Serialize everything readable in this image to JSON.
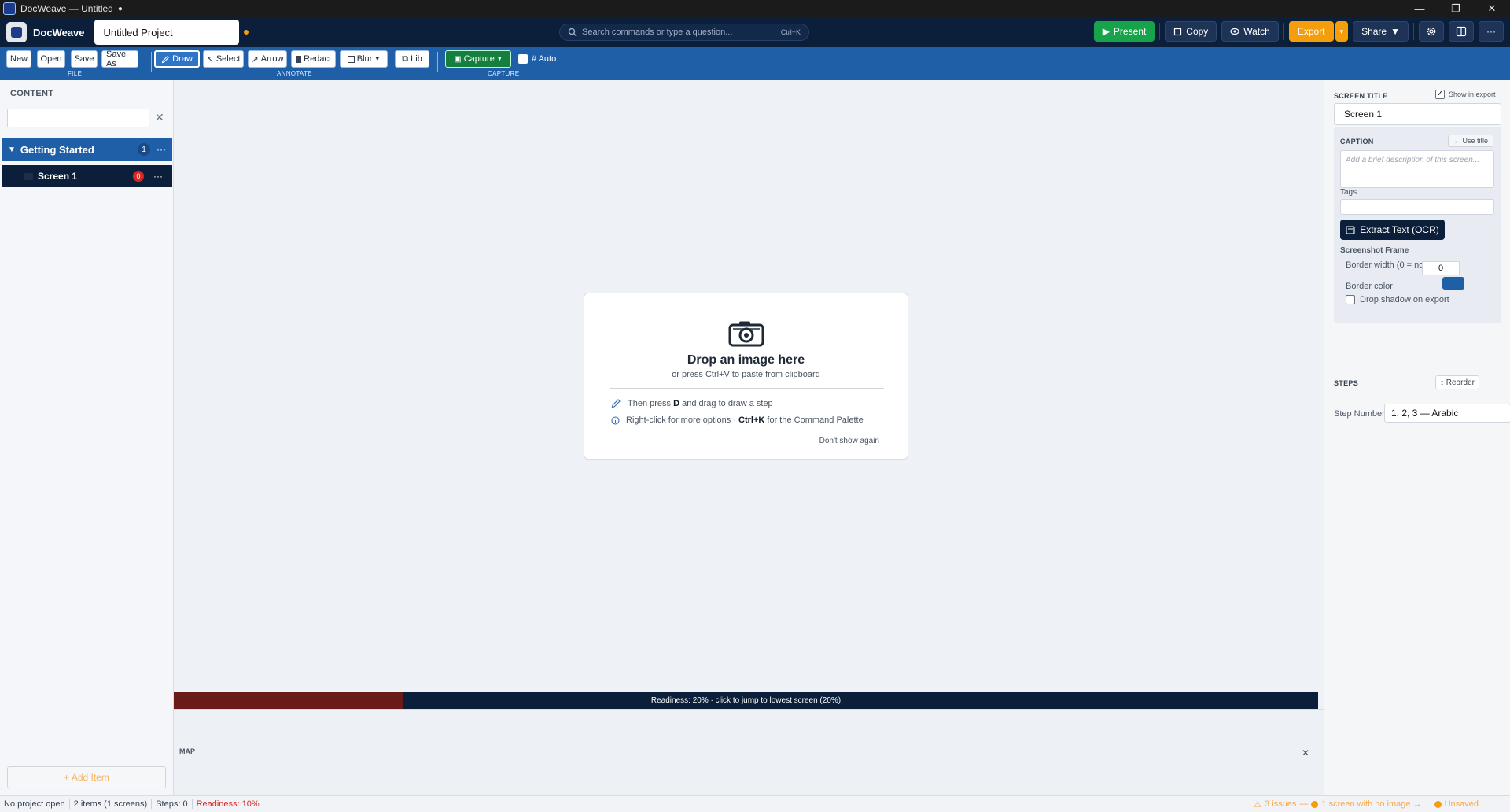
{
  "window": {
    "title": "DocWeave — Untitled",
    "modified_marker": "●",
    "controls": [
      "—",
      "❐",
      "✕"
    ]
  },
  "header": {
    "brand": "DocWeave",
    "project_name": "Untitled Project",
    "search_placeholder": "Search commands or type a question...",
    "search_shortcut": "Ctrl+K",
    "buttons": {
      "present": "Present",
      "copy": "Copy",
      "watch": "Watch",
      "export": "Export",
      "share": "Share"
    },
    "icons": [
      "settings-icon",
      "panel-icon",
      "more-icon"
    ]
  },
  "toolbar": {
    "file": {
      "label": "FILE",
      "new": "New",
      "open": "Open",
      "save": "Save",
      "save_as": "Save As"
    },
    "annotate": {
      "label": "ANNOTATE",
      "draw": "Draw",
      "select": "Select",
      "arrow": "Arrow",
      "redact": "Redact",
      "blur": "Blur",
      "lib": "Lib"
    },
    "capture": {
      "label": "CAPTURE",
      "capture": "Capture",
      "auto": "# Auto"
    }
  },
  "sidebar": {
    "heading": "CONTENT",
    "search_value": "",
    "groups": [
      {
        "label": "Getting Started",
        "count": "1",
        "expanded": true,
        "more": "···"
      }
    ],
    "screens": [
      {
        "label": "Screen 1",
        "badge": "0",
        "more": "···",
        "selected": true
      }
    ],
    "add_item": "+ Add Item"
  },
  "canvas": {
    "drop_title": "Drop an image here",
    "drop_subtitle": "or press Ctrl+V to paste from clipboard",
    "hint1_pre": "Then press ",
    "hint1_key": "D",
    "hint1_post": " and drag to draw a step",
    "hint2_pre": "Right-click for more options · ",
    "hint2_key": "Ctrl+K",
    "hint2_post": " for the Command Palette",
    "dont_show": "Don't show again"
  },
  "readiness_bar": {
    "text": "Readiness: 20%  ·  click to jump to lowest screen (20%)",
    "fraction": 0.2
  },
  "map": {
    "label": "MAP",
    "close": "✕"
  },
  "inspector": {
    "screen_title_label": "SCREEN TITLE",
    "show_in_export": "Show in export",
    "show_in_export_checked": true,
    "screen_title_value": "Screen 1",
    "caption_label": "CAPTION",
    "use_title": "← Use title",
    "caption_placeholder": "Add a brief description of this screen...",
    "tags_label": "Tags",
    "ocr_button": "Extract Text (OCR)",
    "frame_label": "Screenshot Frame",
    "border_width_label": "Border width (0 = none)",
    "border_width_value": "0",
    "border_color_label": "Border color",
    "border_color_value": "#1f5fa8",
    "drop_shadow_label": "Drop shadow on export",
    "drop_shadow_checked": false,
    "steps_label": "STEPS",
    "reorder": "↕ Reorder",
    "step_numbers_label": "Step Numbers:",
    "step_numbers_value": "1, 2, 3  — Arabic"
  },
  "statusbar": {
    "project": "No project open",
    "items": "2 items  (1 screens)",
    "steps": "Steps: 0",
    "readiness": "Readiness: 10%",
    "issues": "3 issues",
    "no_image": "1 screen with no image →",
    "unsaved": "Unsaved"
  },
  "colors": {
    "brand_navy": "#0b1f3a",
    "toolbar_blue": "#1f5fa8",
    "present_green": "#16a34a",
    "export_orange": "#f59e0b",
    "error_red": "#dc2626"
  }
}
